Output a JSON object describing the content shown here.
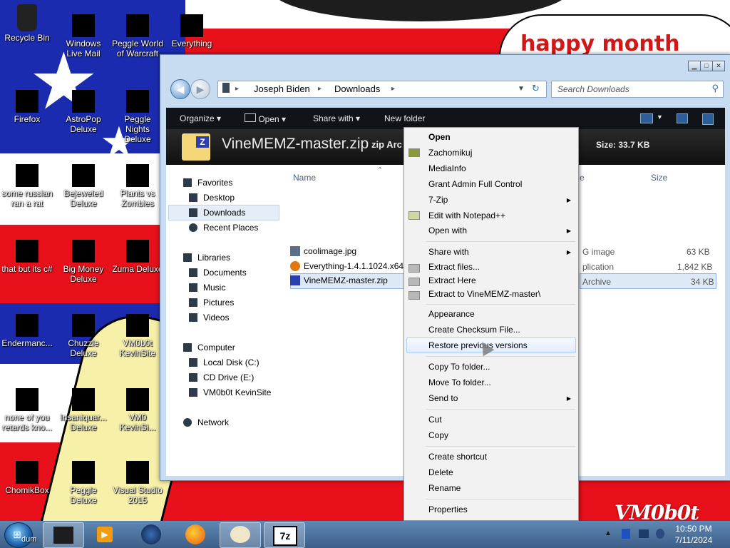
{
  "wallpaper": {
    "banner_text": "happy month",
    "signature": "VM0b0t"
  },
  "desktop_icons": [
    {
      "label": "Recycle Bin",
      "icon": "recycle-bin-icon"
    },
    {
      "label": "Windows Live Mail",
      "icon": "windows-live-mail-icon"
    },
    {
      "label": "Peggle World of Warcraft",
      "icon": "peggle-wow-icon"
    },
    {
      "label": "Everything",
      "icon": "everything-icon"
    },
    {
      "label": "Firefox",
      "icon": "firefox-icon"
    },
    {
      "label": "AstroPop Deluxe",
      "icon": "astropop-icon"
    },
    {
      "label": "Peggle Nights Deluxe",
      "icon": "peggle-nights-icon"
    },
    {
      "label": "some russian ran a rat",
      "icon": "shortcut-icon"
    },
    {
      "label": "Bejeweled Deluxe",
      "icon": "bejeweled-icon"
    },
    {
      "label": "Plants vs Zombies",
      "icon": "pvz-icon"
    },
    {
      "label": "that but its c#",
      "icon": "shortcut-icon"
    },
    {
      "label": "Big Money Deluxe",
      "icon": "big-money-icon"
    },
    {
      "label": "Zuma Deluxe",
      "icon": "zuma-icon"
    },
    {
      "label": "Endermanc...",
      "icon": "shortcut-icon"
    },
    {
      "label": "Chuzzle Deluxe",
      "icon": "chuzzle-icon"
    },
    {
      "label": "VM0b0t KevinSite",
      "icon": "shortcut-icon"
    },
    {
      "label": "none of you retards kno...",
      "icon": "shortcut-icon"
    },
    {
      "label": "Insaniquar... Deluxe",
      "icon": "insaniquarium-icon"
    },
    {
      "label": "VM0 KevinSi...",
      "icon": "shortcut-icon"
    },
    {
      "label": "ChomikBox",
      "icon": "chomikbox-icon"
    },
    {
      "label": "Peggle Deluxe",
      "icon": "peggle-icon"
    },
    {
      "label": "Visual Studio 2015",
      "icon": "visual-studio-icon"
    }
  ],
  "explorer": {
    "address": {
      "segments": [
        "Joseph Biden",
        "Downloads"
      ]
    },
    "search_placeholder": "Search Downloads",
    "toolbar": {
      "organize": "Organize",
      "open": "Open",
      "share_with": "Share with",
      "new_folder": "New folder"
    },
    "details": {
      "filename": "VineMEMZ-master.zip",
      "type": "zip Arc",
      "size": "Size: 33.7 KB"
    },
    "nav": {
      "favorites": "Favorites",
      "desktop": "Desktop",
      "downloads": "Downloads",
      "recent_places": "Recent Places",
      "libraries": "Libraries",
      "documents": "Documents",
      "music": "Music",
      "pictures": "Pictures",
      "videos": "Videos",
      "computer": "Computer",
      "local_disk": "Local Disk (C:)",
      "cd_drive": "CD Drive (E:)",
      "vm_site": "VM0b0t KevinSite",
      "network": "Network"
    },
    "columns": {
      "name": "Name",
      "type_partial": "e",
      "size": "Size"
    },
    "files": [
      {
        "name": "coolimage.jpg",
        "type": "G image",
        "size": "63 KB"
      },
      {
        "name": "Everything-1.4.1.1024.x64-",
        "type": "plication",
        "size": "1,842 KB"
      },
      {
        "name": "VineMEMZ-master.zip",
        "type": "Archive",
        "size": "34 KB"
      }
    ]
  },
  "context_menu": {
    "items": {
      "open": "Open",
      "zachomikuj": "Zachomikuj",
      "mediainfo": "MediaInfo",
      "grant_admin": "Grant Admin Full Control",
      "seven_zip": "7-Zip",
      "edit_notepad": "Edit with Notepad++",
      "open_with": "Open with",
      "share_with": "Share with",
      "extract_files": "Extract files...",
      "extract_here": "Extract Here",
      "extract_to": "Extract to VineMEMZ-master\\",
      "appearance": "Appearance",
      "create_checksum": "Create Checksum File...",
      "restore_prev": "Restore previous versions",
      "copy_to": "Copy To folder...",
      "move_to": "Move To folder...",
      "send_to": "Send to",
      "cut": "Cut",
      "copy": "Copy",
      "create_shortcut": "Create shortcut",
      "delete": "Delete",
      "rename": "Rename",
      "properties": "Properties"
    }
  },
  "taskbar": {
    "time": "10:50 PM",
    "date": "7/11/2024",
    "start_label": "dum"
  }
}
